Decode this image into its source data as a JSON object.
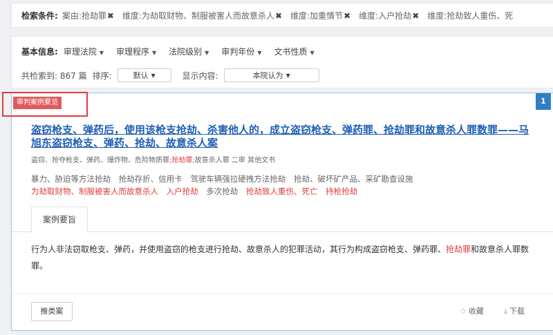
{
  "filters": {
    "label": "检索条件:",
    "tags": [
      "案由:抢劫罪",
      "维度:为劫取财物、制服被害人而故意杀人",
      "维度:加重情节",
      "维度:入户抢劫",
      "维度:抢劫致人重伤、死"
    ]
  },
  "basic": {
    "label": "基本信息:",
    "dropdowns": [
      "审理法院",
      "审理程序",
      "法院级别",
      "审判年份",
      "文书性质"
    ]
  },
  "results": {
    "count_text": "共检索到:",
    "count": "867",
    "unit": "篇",
    "sort_label": "排序:",
    "sort_value": "默认",
    "display_label": "显示内容:",
    "display_value": "本院认为"
  },
  "case": {
    "ribbon": "审判案例要览",
    "number": "1",
    "title": "盗窃枪支、弹药后，使用该枪支抢劫、杀害他人的，成立盗窃枪支、弹药罪、抢劫罪和故意杀人罪数罪——马旭东盗窃枪支、弹药、抢劫、故意杀人案",
    "meta_pre": "盗窃、抢夺枪支、弹药、爆炸物、危险物质罪;",
    "meta_red": "抢劫罪",
    "meta_post": ";故意杀人罪   二审   其他文书",
    "keywords_row1": [
      "暴力、胁迫等方法抢劫",
      "抢劫存折、信用卡",
      "驾驶车辆强拉硬拽方法抢劫",
      "抢劫、破坏矿产品、采矿勘查设施"
    ],
    "keywords_row2": [
      {
        "text": "为劫取财物、制服被害人而故意杀人",
        "red": true
      },
      {
        "text": "入户抢劫",
        "red": true
      },
      {
        "text": "多次抢劫",
        "red": false
      },
      {
        "text": "抢劫致人重伤、死亡",
        "red": true
      },
      {
        "text": "持枪抢劫",
        "red": true
      }
    ],
    "tab": "案例要旨",
    "summary_pre": "行为人非法窃取枪支、弹药，并使用盗窃的枪支进行抢劫、故意杀人的犯罪活动，其行为构成盗窃枪支、弹药罪、",
    "summary_red": "抢劫罪",
    "summary_post": "和故意杀人罪数罪。",
    "similar_btn": "推类案",
    "fav": "收藏",
    "download": "下载"
  }
}
